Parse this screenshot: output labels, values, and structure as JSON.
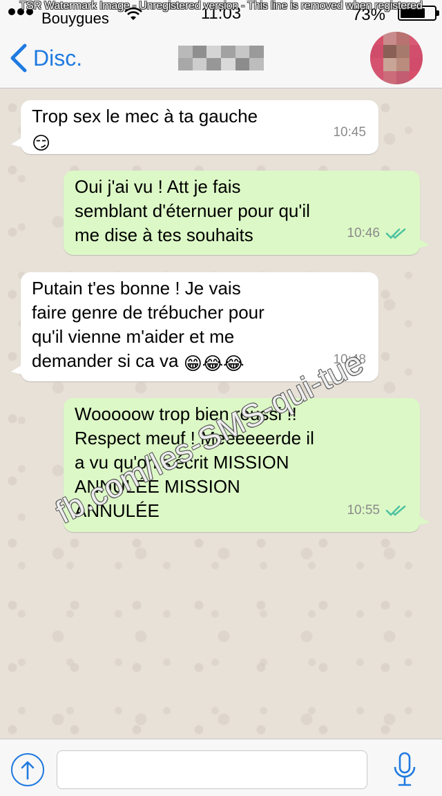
{
  "watermark_top": "TSR Watermark Image - Unregistered version - This line is removed when registered",
  "status_bar": {
    "carrier": "Bouygues",
    "time": "11:03",
    "battery": "73%"
  },
  "nav": {
    "back_label": "Disc.",
    "contact_name": "",
    "icons": [
      "chevron-left-icon",
      "avatar"
    ]
  },
  "colors": {
    "accent": "#1f7ae0",
    "incoming_bubble": "#ffffff",
    "outgoing_bubble": "#dcf8c6",
    "read_ticks": "#4fc3a1"
  },
  "messages": [
    {
      "direction": "in",
      "text": "Trop sex le mec à ta gauche",
      "emoji": "😏",
      "time": "10:45"
    },
    {
      "direction": "out",
      "text": "Oui j'ai vu ! Att je fais\nsemblant d'éternuer pour qu'il\nme dise à tes souhaits",
      "time": "10:46",
      "status": "read"
    },
    {
      "direction": "in",
      "text": "Putain t'es bonne ! Je vais\nfaire genre de trébucher pour\nqu'il vienne m'aider et me\ndemander si ca va",
      "emoji": "😁😂😂",
      "time": "10:48"
    },
    {
      "direction": "out",
      "text": "Wooooow trop bien reussi !!\nRespect meuf ! Meeeeeerde il\na vu qu'on s'écrit MISSION\nANNULÉE MISSION\nANNULÉE",
      "time": "10:55",
      "status": "read"
    }
  ],
  "overlay_watermark": "fb.com/les-SMS-qui-tue",
  "input_bar": {
    "placeholder": "",
    "icons": [
      "share-icon",
      "microphone-icon"
    ]
  }
}
